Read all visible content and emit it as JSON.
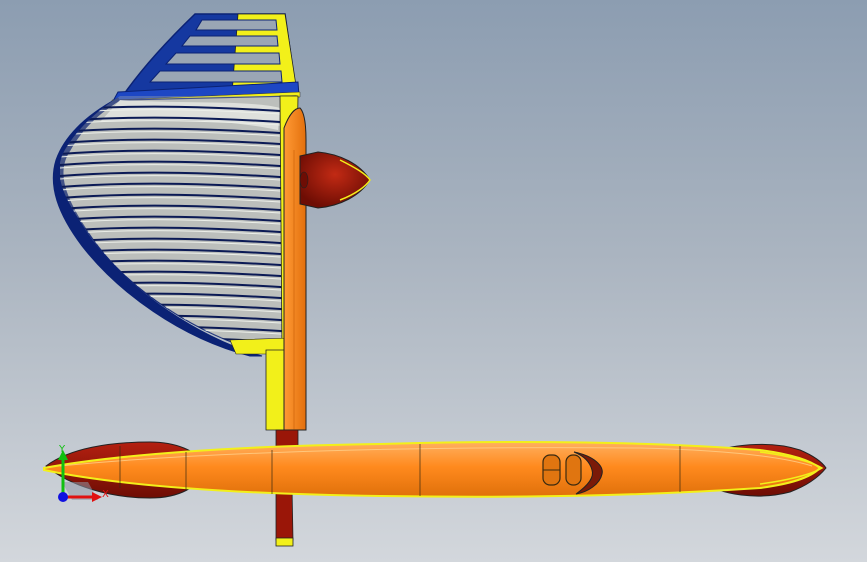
{
  "viewport": {
    "background_top": "#8c9db1",
    "background_bottom": "#d3d7dc"
  },
  "model": {
    "colors": {
      "fuselage_orange": "#ff8a1e",
      "fuselage_light": "#ffa24a",
      "edge_yellow": "#f2f01a",
      "nacelle_red": "#9a1608",
      "nacelle_dark": "#6e0d04",
      "wing_blue": "#1538a0",
      "wing_dark_blue": "#0b2275",
      "rib_gray": "#cfd2cf"
    }
  },
  "triad": {
    "x_label": "X",
    "y_label": "Y",
    "x_color": "#e01010",
    "y_color": "#10c010",
    "z_color": "#1010e0"
  }
}
